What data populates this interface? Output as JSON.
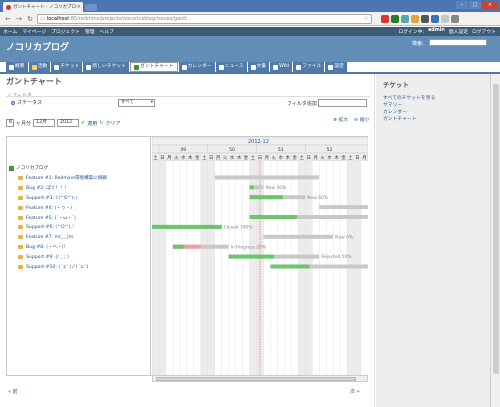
{
  "browser": {
    "tab_title": "ガントチャート - ノコリカプログ - Redm",
    "url_host": "localhost",
    "url_path": ":85/redmine/projects/nocoricablog/issues/gantt"
  },
  "topmenu": {
    "items": [
      "ホーム",
      "マイページ",
      "プロジェクト",
      "管理",
      "ヘルプ"
    ],
    "login_label": "ログイン中:",
    "user": "admin",
    "personal": "個人設定",
    "logout": "ログアウト"
  },
  "header": {
    "project_title": "ノコリカプログ",
    "search_label": "検索:"
  },
  "mainmenu": {
    "items": [
      {
        "label": "概要",
        "selected": false,
        "icon_color": "#ffffff"
      },
      {
        "label": "活動",
        "selected": false,
        "icon_color": "#ffcc66"
      },
      {
        "label": "チケット",
        "selected": false,
        "icon_color": "#ffffff"
      },
      {
        "label": "新しいチケット",
        "selected": false,
        "icon_color": "#ffffff"
      },
      {
        "label": "ガントチャート",
        "selected": true,
        "icon_color": "#2e9b2e"
      },
      {
        "label": "カレンダー",
        "selected": false,
        "icon_color": "#ffffff"
      },
      {
        "label": "ニュース",
        "selected": false,
        "icon_color": "#ffffff"
      },
      {
        "label": "文書",
        "selected": false,
        "icon_color": "#ffffff"
      },
      {
        "label": "Wiki",
        "selected": false,
        "icon_color": "#ffffff"
      },
      {
        "label": "ファイル",
        "selected": false,
        "icon_color": "#ffffff"
      },
      {
        "label": "設定",
        "selected": false,
        "icon_color": "#ffffff"
      }
    ]
  },
  "page": {
    "title": "ガントチャート",
    "filter_label": "フィルタ",
    "status_label": "ステータス",
    "status_value": "すべて",
    "add_filter_label": "フィルタ追加",
    "months_value": "6",
    "months_label": "ヶ月分",
    "month_value": "12月",
    "year_value": "2012",
    "apply": "適用",
    "clear": "クリア",
    "zoom_in": "拡大",
    "zoom_out": "縮小",
    "prev": "« 前",
    "next": "次 »"
  },
  "chart_data": {
    "type": "gantt",
    "month": "2012-12",
    "weeks": [
      "49",
      "50",
      "51",
      "52"
    ],
    "days": [
      "土",
      "日",
      "月",
      "火",
      "水",
      "木",
      "金",
      "土",
      "日",
      "月",
      "火",
      "水",
      "木",
      "金",
      "土",
      "日",
      "月",
      "火",
      "水",
      "木",
      "金",
      "土",
      "日",
      "月",
      "火",
      "水",
      "木",
      "金",
      "土",
      "日",
      "月"
    ],
    "project": "ノコリカプログ",
    "issues": [
      {
        "subject": "Feature #1: Redmine環境構築に挑戦",
        "label": "",
        "done": 0,
        "late": false
      },
      {
        "subject": "Bug #2: ぱぐ！！！",
        "label": "New 30%",
        "done": 0.3,
        "late": false
      },
      {
        "subject": "Support #3: ♪(^O^)ㇵ",
        "label": "New 60%",
        "done": 0.6,
        "late": false
      },
      {
        "subject": "Feature #4: (・ヮ・)",
        "label": "New 0%",
        "done": 0,
        "late": false
      },
      {
        "subject": "Feature #5: (´・ω・`)",
        "label": "New 40%",
        "done": 0.4,
        "late": false
      },
      {
        "subject": "Support #6: (^O^)／",
        "label": "Closed 100%",
        "done": 1,
        "late": false
      },
      {
        "subject": "Feature #7: m(_ _)m",
        "label": "New 0%",
        "done": 0,
        "late": false
      },
      {
        "subject": "Bug #8: (・ヘ・)!",
        "label": "In Progress 20%",
        "done": 0.2,
        "late": true
      },
      {
        "subject": "Support #9: (/ _ ; )",
        "label": "Rejected 50%",
        "done": 0.5,
        "late": false
      },
      {
        "subject": "Support #10: (´ェ`)ノ(´ェ`)",
        "label": "Feedback 40%",
        "done": 0.4,
        "late": false
      }
    ]
  },
  "sidebar": {
    "title": "チケット",
    "links": [
      "すべてのチケットを見る",
      "サマリー",
      "カレンダー",
      "ガントチャート"
    ]
  },
  "colors": {
    "header": "#628db6",
    "topmenu": "#3e5b76",
    "done": "#6cc46c",
    "todo": "#c8c8c8",
    "late": "#f0a0a0",
    "today": "#ff4444"
  }
}
